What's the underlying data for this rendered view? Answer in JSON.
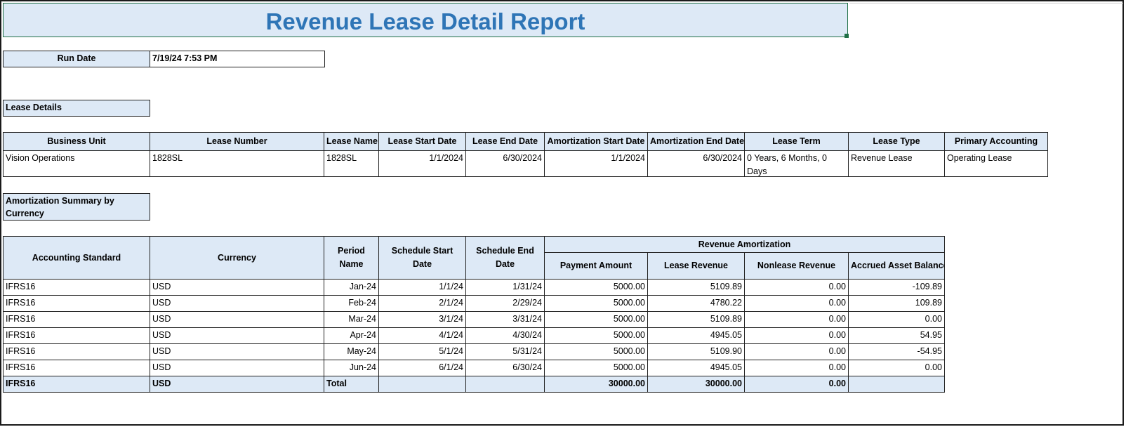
{
  "report": {
    "title": "Revenue Lease Detail Report"
  },
  "run": {
    "label": "Run Date",
    "value": "7/19/24 7:53 PM"
  },
  "lease_details": {
    "section_label": "Lease Details",
    "headers": [
      "Business Unit",
      "Lease Number",
      "Lease Name",
      "Lease Start Date",
      "Lease End Date",
      "Amortization Start Date",
      "Amortization End Date",
      "Lease Term",
      "Lease Type",
      "Primary Accounting"
    ],
    "row": [
      "Vision Operations",
      "1828SL",
      "1828SL",
      "1/1/2024",
      "6/30/2024",
      "1/1/2024",
      "6/30/2024",
      "0 Years, 6 Months, 0 Days",
      "Revenue Lease",
      "Operating Lease"
    ]
  },
  "amortization": {
    "section_label": "Amortization Summary by Currency",
    "group_header": "Revenue Amortization",
    "headers": [
      "Accounting Standard",
      "Currency",
      "Period Name",
      "Schedule Start Date",
      "Schedule End Date",
      "Payment Amount",
      "Lease Revenue",
      "Nonlease Revenue",
      "Accrued Asset Balance"
    ],
    "rows": [
      [
        "IFRS16",
        "USD",
        "Jan-24",
        "1/1/24",
        "1/31/24",
        "5000.00",
        "5109.89",
        "0.00",
        "-109.89"
      ],
      [
        "IFRS16",
        "USD",
        "Feb-24",
        "2/1/24",
        "2/29/24",
        "5000.00",
        "4780.22",
        "0.00",
        "109.89"
      ],
      [
        "IFRS16",
        "USD",
        "Mar-24",
        "3/1/24",
        "3/31/24",
        "5000.00",
        "5109.89",
        "0.00",
        "0.00"
      ],
      [
        "IFRS16",
        "USD",
        "Apr-24",
        "4/1/24",
        "4/30/24",
        "5000.00",
        "4945.05",
        "0.00",
        "54.95"
      ],
      [
        "IFRS16",
        "USD",
        "May-24",
        "5/1/24",
        "5/31/24",
        "5000.00",
        "5109.90",
        "0.00",
        "-54.95"
      ],
      [
        "IFRS16",
        "USD",
        "Jun-24",
        "6/1/24",
        "6/30/24",
        "5000.00",
        "4945.05",
        "0.00",
        "0.00"
      ]
    ],
    "total": [
      "IFRS16",
      "USD",
      "Total",
      "",
      "",
      "30000.00",
      "30000.00",
      "0.00",
      ""
    ]
  }
}
